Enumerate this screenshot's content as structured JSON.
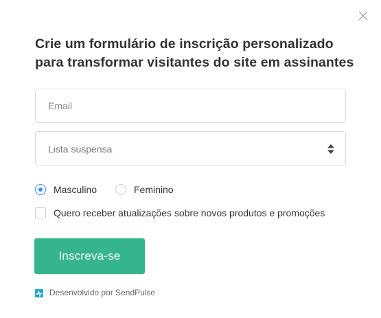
{
  "form": {
    "close_icon": "close-icon",
    "title_line1": "Crie um formulário de inscrição personalizado",
    "title_line2": "para transformar visitantes do site em assinantes",
    "email_placeholder": "Email",
    "select": {
      "placeholder": "Lista suspensa",
      "icon": "sort-arrows-icon"
    },
    "gender": {
      "options": [
        {
          "label": "Masculino",
          "selected": true
        },
        {
          "label": "Feminino",
          "selected": false
        }
      ]
    },
    "consent_label": "Quero receber atualizações sobre novos produtos e promoções",
    "consent_checked": false,
    "submit_label": "Inscreva-se",
    "footer": {
      "icon": "sendpulse-logo-icon",
      "text": "Desenvolvido por SendPulse"
    }
  },
  "colors": {
    "button": "#35b58b",
    "radio_selected": "#3d8ef5",
    "border": "#dcdcdc",
    "logo": "#1fa9c8"
  }
}
